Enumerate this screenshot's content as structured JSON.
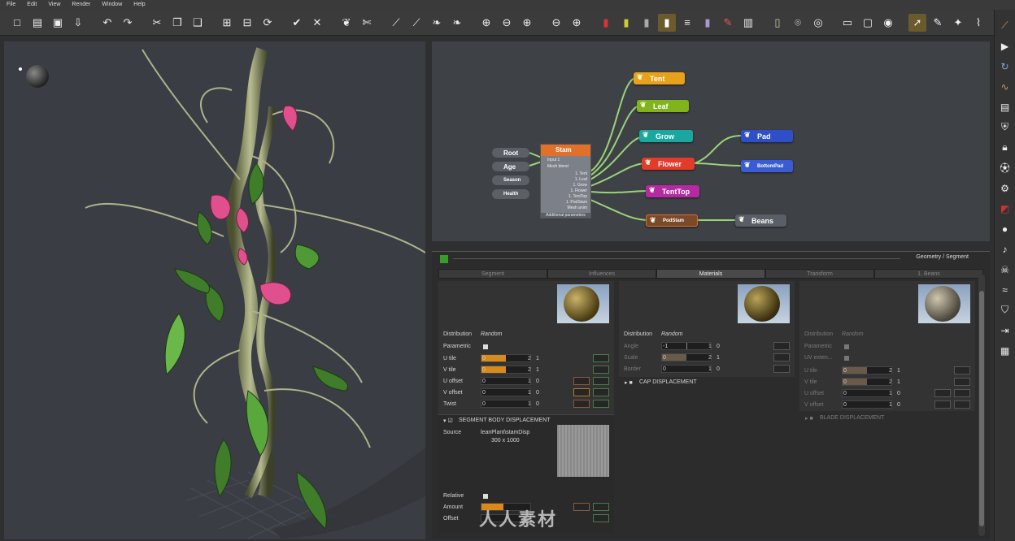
{
  "menu": [
    "File",
    "Edit",
    "View",
    "Render",
    "Window",
    "Help"
  ],
  "toolbar_icons": [
    "new-file-icon",
    "open-file-icon",
    "save-icon",
    "import-icon",
    "undo-icon",
    "redo-icon",
    "cut-icon",
    "copy-icon",
    "paste-icon",
    "group-icon",
    "ungroup-icon",
    "refresh-icon",
    "check-icon",
    "delete-icon",
    "plant-icon",
    "scissors-leaf-icon",
    "stem-icon",
    "branch-icon",
    "leaf-icon",
    "frond-icon",
    "zoom-node-icon",
    "remove-node-icon",
    "add-node-icon",
    "remove-icon",
    "add-icon",
    "cylinder-red-icon",
    "cylinder-yellow-icon",
    "cylinder-grey-icon",
    "cylinder-white-icon",
    "bars-icon",
    "tube-icon",
    "paint-icon",
    "bin-icon",
    "ruler-icon",
    "camera-icon",
    "compass-icon",
    "film-icon",
    "window-icon",
    "render-icon",
    "select-icon",
    "pen-icon",
    "wand-icon",
    "bones-icon"
  ],
  "right_icons": [
    "stem-tool-icon",
    "play-icon",
    "rotate-icon",
    "curve-icon",
    "palette-icon",
    "shield-icon",
    "lock-icon",
    "soccer-icon",
    "gear-icon",
    "color-icon",
    "circle-icon",
    "note-icon",
    "skull-icon",
    "wave-icon",
    "badge-icon",
    "export-icon",
    "grid-icon"
  ],
  "graph": {
    "inputs": [
      "Root",
      "Age",
      "Season",
      "Health"
    ],
    "stem": {
      "title": "Stam",
      "ports": [
        "Input 1",
        "Mesh blend"
      ],
      "outputs": [
        "1. Tent",
        "1. Leaf",
        "1. Grow",
        "1. Flower",
        "1. TentTop",
        "1. PodStam",
        "Mesh anim"
      ],
      "footer": "Additional parameters"
    },
    "nodes": [
      {
        "label": "Tent",
        "color": "#e8a21a"
      },
      {
        "label": "Leaf",
        "color": "#7fb41d"
      },
      {
        "label": "Grow",
        "color": "#1aa7a0"
      },
      {
        "label": "Flower",
        "color": "#e23b2a"
      },
      {
        "label": "TentTop",
        "color": "#b52aa0"
      },
      {
        "label": "PodStam",
        "color": "#7a4a2a"
      },
      {
        "label": "Pad",
        "color": "#2f4fc8"
      },
      {
        "label": "BottomPad",
        "color": "#3a5bd2"
      },
      {
        "label": "Beans",
        "color": "#5a5e66"
      }
    ]
  },
  "props": {
    "header": "Geometry / Segment",
    "tabs": [
      "Segment",
      "Influences",
      "Materials",
      "Transform",
      "1. Beans"
    ],
    "col1": {
      "distribution_label": "Distribution",
      "distribution_value": "Random",
      "parametric": "Parametric",
      "u_tile": "U tile",
      "u_tile_min": "0",
      "u_tile_max": "2",
      "u_tile_val": "1",
      "v_tile": "V tile",
      "v_tile_min": "0",
      "v_tile_max": "2",
      "v_tile_val": "1",
      "u_offset": "U offset",
      "u_offset_min": "0",
      "u_offset_max": "1",
      "u_offset_val": "0",
      "v_offset": "V offset",
      "v_offset_min": "0",
      "v_offset_max": "1",
      "v_offset_val": "0",
      "twist": "Twist",
      "twist_min": "0",
      "twist_max": "1",
      "twist_val": "0",
      "section": "SEGMENT BODY DISPLACEMENT",
      "source_label": "Source",
      "source_value": "leanPlant\\stamDisp",
      "source_size": "300 x 1000",
      "relative": "Relative",
      "amount": "Amount",
      "offset": "Offset"
    },
    "col2": {
      "distribution_label": "Distribution",
      "distribution_value": "Random",
      "angle": "Angle",
      "angle_min": "-1",
      "angle_max": "1",
      "angle_val": "0",
      "scale": "Scale",
      "scale_min": "0",
      "scale_max": "2",
      "scale_val": "1",
      "border": "Border",
      "border_min": "0",
      "border_max": "1",
      "border_val": "0",
      "section": "CAP DISPLACEMENT"
    },
    "col3": {
      "distribution_label": "Distribution",
      "distribution_value": "Random",
      "parametric": "Parametric",
      "uv": "UV exten...",
      "u_tile": "U tile",
      "u_tile_min": "0",
      "u_tile_max": "2",
      "u_tile_val": "1",
      "v_tile": "V tile",
      "v_tile_min": "0",
      "v_tile_max": "2",
      "v_tile_val": "1",
      "u_offset": "U offset",
      "u_offset_min": "0",
      "u_offset_max": "1",
      "u_offset_val": "0",
      "v_offset": "V offset",
      "v_offset_min": "0",
      "v_offset_max": "1",
      "v_offset_val": "0",
      "section": "BLADE DISPLACEMENT"
    }
  },
  "watermark": "人人素材"
}
